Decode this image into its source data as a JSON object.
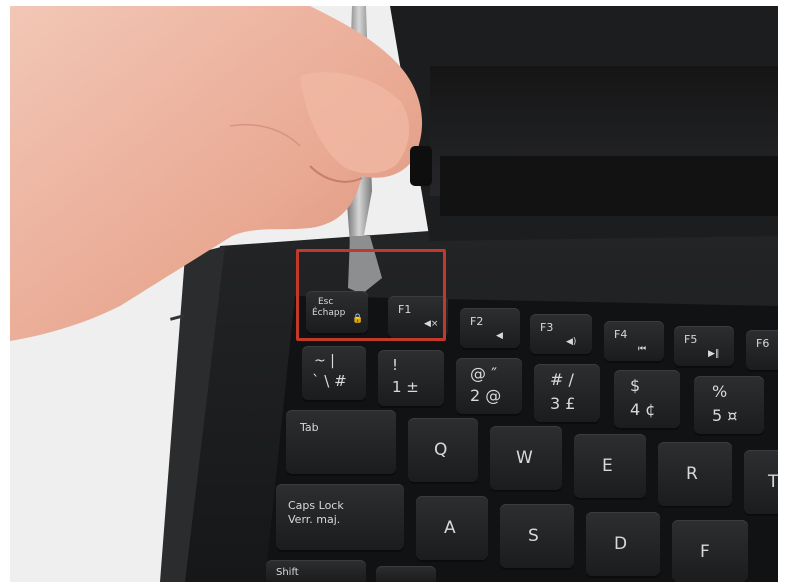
{
  "keys": {
    "esc": "Esc",
    "echap": "Échapp",
    "f1": "F1",
    "f2": "F2",
    "f3": "F3",
    "f4": "F4",
    "f5": "F5",
    "f6": "F6",
    "tilde": "~ |",
    "bkslash": "` \\ #",
    "one_top": "!",
    "one": "1 ±",
    "two_top": "@ ″",
    "two": "2 @",
    "three_top": "# /",
    "three": "3 £",
    "four_top": "$",
    "four": "4 ¢",
    "five_top": "%",
    "five": "5 ¤",
    "tab": "Tab",
    "q": "Q",
    "w": "W",
    "e": "E",
    "r": "R",
    "t": "T",
    "caps1": "Caps Lock",
    "caps2": "Verr. maj.",
    "a": "A",
    "s": "S",
    "d": "D",
    "f": "F",
    "shift": "Shift"
  },
  "colors": {
    "highlight": "#c0392b",
    "keycap": "#1e1f21",
    "legend": "#d9d9d9"
  }
}
